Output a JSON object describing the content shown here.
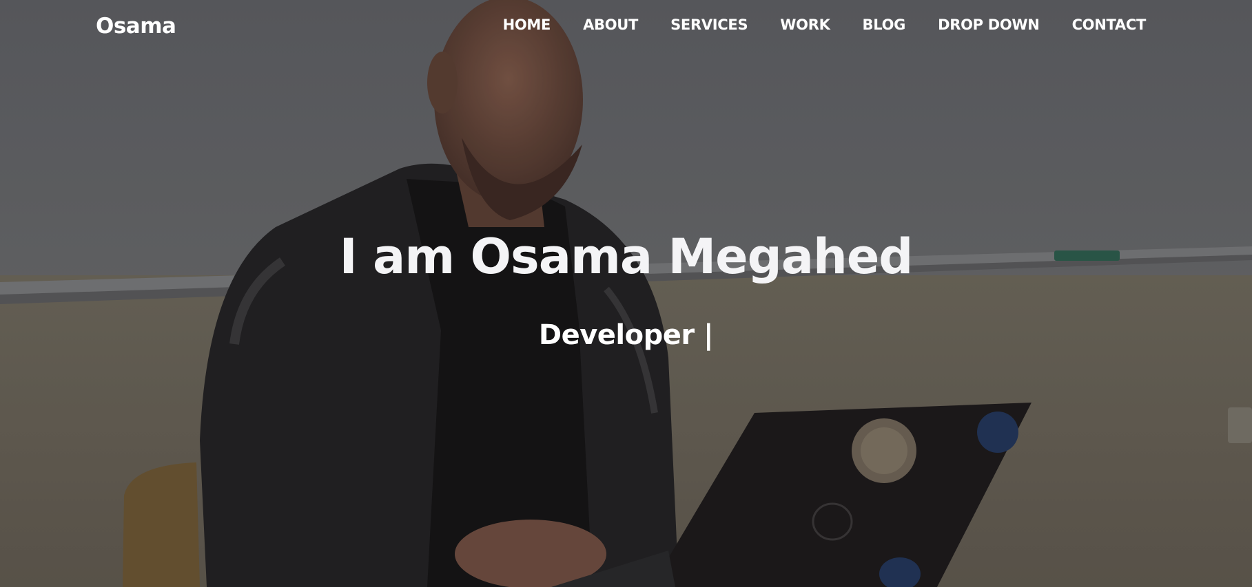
{
  "navbar": {
    "brand": "Osama",
    "items": [
      {
        "label": "HOME"
      },
      {
        "label": "ABOUT"
      },
      {
        "label": "SERVICES"
      },
      {
        "label": "WORK"
      },
      {
        "label": "BLOG"
      },
      {
        "label": "DROP DOWN"
      },
      {
        "label": "CONTACT"
      }
    ]
  },
  "hero": {
    "title": "I am Osama Megahed",
    "subtitle": "Developer |",
    "background_description_icon": "photo-man-with-laptop"
  },
  "colors": {
    "wall_top": "#5f6064",
    "wall_bottom": "#6b6558",
    "jacket": "#232224",
    "laptop": "#1e1b1c",
    "text": "#ffffff"
  }
}
